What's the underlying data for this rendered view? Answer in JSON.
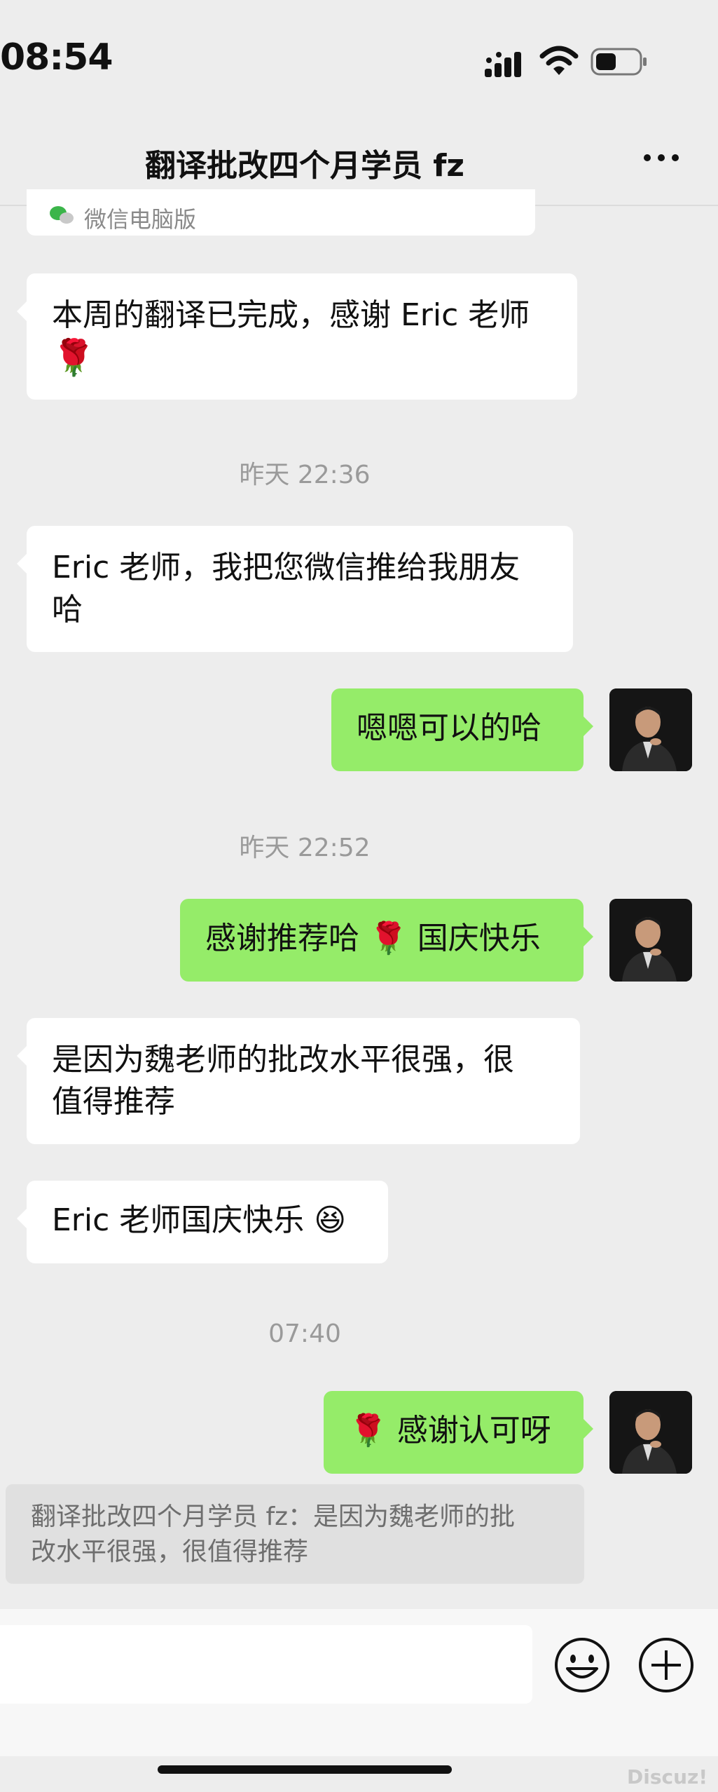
{
  "status_bar": {
    "time": "08:54"
  },
  "nav": {
    "title": "翻译批改四个月学员 fz",
    "more_icon": "more-icon"
  },
  "messages": [
    {
      "side": "left",
      "text": "微信电脑版"
    },
    {
      "side": "left",
      "text_a": "本周的翻译已完成，感谢 Eric 老师",
      "emoji": "🌹"
    },
    {
      "timestamp": "昨天 22:36"
    },
    {
      "side": "left",
      "text_a": "Eric 老师，我把您微信推给我朋友",
      "text_b": "哈"
    },
    {
      "side": "right",
      "text": "嗯嗯可以的哈"
    },
    {
      "timestamp": "昨天 22:52"
    },
    {
      "side": "right",
      "text_a": "感谢推荐哈",
      "emoji": "🌹",
      "text_b": "国庆快乐"
    },
    {
      "side": "left",
      "text_a": "是因为魏老师的批改水平很强，很",
      "text_b": "值得推荐"
    },
    {
      "side": "left",
      "text_a": "Eric 老师国庆快乐",
      "emoji": "😆"
    },
    {
      "timestamp": "07:40"
    },
    {
      "side": "right",
      "emoji": "🌹",
      "text_b": "感谢认可呀"
    }
  ],
  "quote": {
    "line1": "翻译批改四个月学员 fz：是因为魏老师的批",
    "line2": "改水平很强，很值得推荐"
  },
  "watermark": "Discuz!",
  "colors": {
    "background": "#ededed",
    "sent_bubble": "#95ec69",
    "received_bubble": "#ffffff"
  }
}
